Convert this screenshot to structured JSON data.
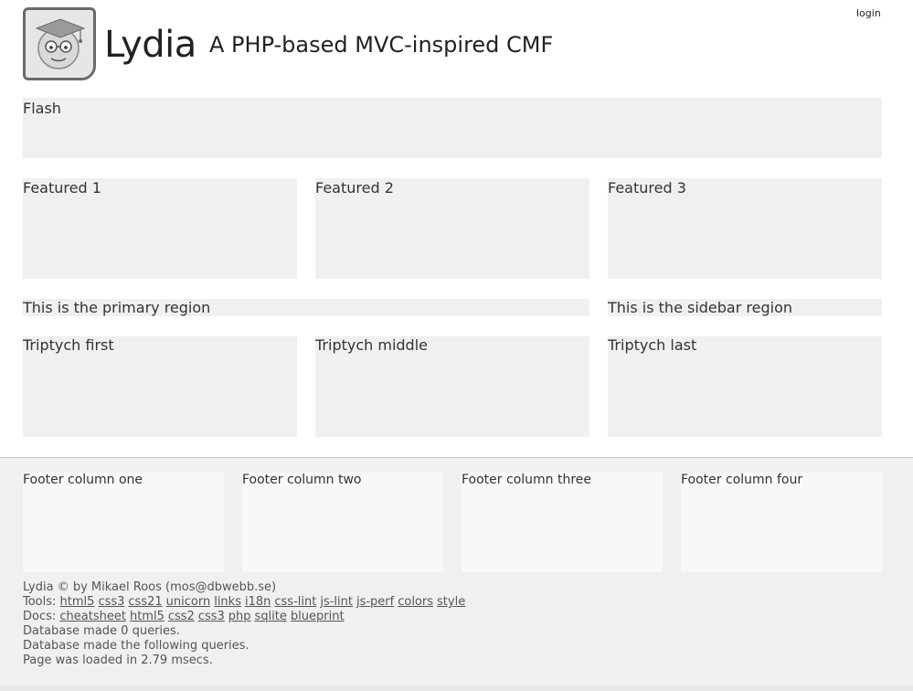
{
  "header": {
    "login": "login",
    "site_title": "Lydia",
    "slogan": "A PHP-based MVC-inspired CMF"
  },
  "flash": {
    "label": "Flash"
  },
  "featured": [
    {
      "label": "Featured 1"
    },
    {
      "label": "Featured 2"
    },
    {
      "label": "Featured 3"
    }
  ],
  "primary": {
    "label": "This is the primary region"
  },
  "sidebar": {
    "label": "This is the sidebar region"
  },
  "triptych": [
    {
      "label": "Triptych first"
    },
    {
      "label": "Triptych middle"
    },
    {
      "label": "Triptych last"
    }
  ],
  "footer": {
    "columns": [
      {
        "label": "Footer column one"
      },
      {
        "label": "Footer column two"
      },
      {
        "label": "Footer column three"
      },
      {
        "label": "Footer column four"
      }
    ],
    "copyright": "Lydia © by Mikael Roos (mos@dbwebb.se)",
    "tools_prefix": "Tools:",
    "tools": [
      "html5",
      "css3",
      "css21",
      "unicorn",
      "links",
      "i18n",
      "css-lint",
      "js-lint",
      "js-perf",
      "colors",
      "style"
    ],
    "docs_prefix": "Docs:",
    "docs": [
      "cheatsheet",
      "html5",
      "css2",
      "css3",
      "php",
      "sqlite",
      "blueprint"
    ],
    "db_queries": "Database made 0 queries.",
    "db_following": "Database made the following queries.",
    "load_time": "Page was loaded in 2.79 msecs."
  }
}
